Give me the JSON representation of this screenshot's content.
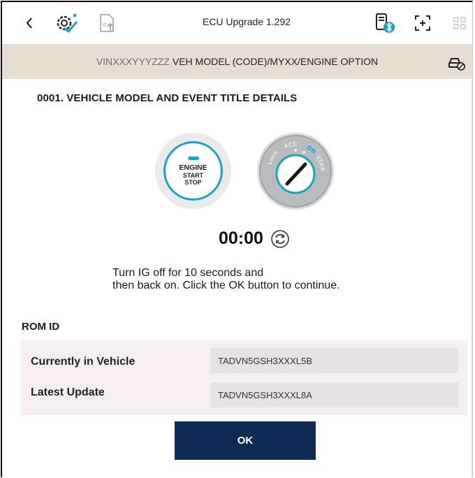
{
  "toolbar": {
    "title": "ECU Upgrade 1.292",
    "icons": [
      "back-icon",
      "gear-check-icon",
      "upload-icon",
      "bluetooth-device-icon",
      "screenshot-icon",
      "grid-icon"
    ]
  },
  "vehicle_bar": {
    "vin": "VINXXXYYYZZZ",
    "details": "VEH MODEL (CODE)/MYXX/ENGINE OPTION"
  },
  "event": {
    "title": "0001. VEHICLE MODEL AND EVENT TITLE DETAILS"
  },
  "engine_button": {
    "line1": "ENGINE",
    "line2": "START",
    "line3": "STOP"
  },
  "ignition": {
    "positions": [
      "Lock",
      "ACC",
      "ON",
      "START"
    ]
  },
  "timer": {
    "value": "00:00"
  },
  "instructions": {
    "line1": "Turn IG off for 10 seconds and",
    "line2": "then back on. Click the OK button to continue."
  },
  "rom": {
    "heading": "ROM ID",
    "rows": [
      {
        "label": "Currently in Vehicle",
        "value": "TADVN5GSH3XXXL5B"
      },
      {
        "label": "Latest Update",
        "value": "TADVN5GSH3XXXL8A"
      }
    ]
  },
  "ok_button": {
    "label": "OK"
  },
  "colors": {
    "accent": "#1ba3c6",
    "navy": "#0f2b54",
    "vehicle_bar": "#e6ddd3",
    "rom_panel": "#f6eeef"
  }
}
